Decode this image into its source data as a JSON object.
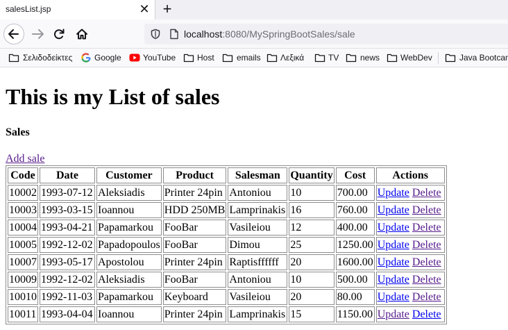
{
  "browser": {
    "tab": {
      "title": "salesList.jsp",
      "close_glyph": "✕"
    },
    "new_tab_glyph": "+",
    "url": {
      "host": "localhost",
      "rest": ":8080/MySpringBootSales/sale"
    },
    "bookmarks": [
      {
        "label": "Σελιδοδείκτες",
        "icon": "folder-icon"
      },
      {
        "label": "Google",
        "icon": "google-icon"
      },
      {
        "label": "YouTube",
        "icon": "youtube-icon"
      },
      {
        "label": "Host",
        "icon": "folder-icon"
      },
      {
        "label": "emails",
        "icon": "folder-icon"
      },
      {
        "label": "Λεξικά",
        "icon": "folder-icon"
      },
      {
        "label": "TV",
        "icon": "folder-icon"
      },
      {
        "label": "news",
        "icon": "folder-icon"
      },
      {
        "label": "WebDev",
        "icon": "folder-icon"
      },
      {
        "label": "Java Bootcam",
        "icon": "folder-icon"
      }
    ]
  },
  "page": {
    "title": "This is my List of sales",
    "subtitle": "Sales",
    "add_link": "Add sale"
  },
  "table": {
    "headers": [
      "Code",
      "Date",
      "Customer",
      "Product",
      "Salesman",
      "Quantity",
      "Cost",
      "Actions"
    ],
    "update_label": "Update",
    "delete_label": "Delete",
    "rows": [
      {
        "code": "10002",
        "date": "1993-07-12",
        "customer": "Aleksiadis",
        "product": "Printer 24pin",
        "salesman": "Antoniou",
        "quantity": "10",
        "cost": "700.00"
      },
      {
        "code": "10003",
        "date": "1993-03-15",
        "customer": "Ioannou",
        "product": "HDD 250MB",
        "salesman": "Lamprinakis",
        "quantity": "16",
        "cost": "760.00"
      },
      {
        "code": "10004",
        "date": "1993-04-21",
        "customer": "Papamarkou",
        "product": "FooBar",
        "salesman": "Vasileiou",
        "quantity": "12",
        "cost": "400.00"
      },
      {
        "code": "10005",
        "date": "1992-12-02",
        "customer": "Papadopoulos",
        "product": "FooBar",
        "salesman": "Dimou",
        "quantity": "25",
        "cost": "1250.00"
      },
      {
        "code": "10007",
        "date": "1993-05-17",
        "customer": "Apostolou",
        "product": "Printer 24pin",
        "salesman": "Raptisffffff",
        "quantity": "20",
        "cost": "1600.00"
      },
      {
        "code": "10009",
        "date": "1992-12-02",
        "customer": "Aleksiadis",
        "product": "FooBar",
        "salesman": "Antoniou",
        "quantity": "10",
        "cost": "500.00"
      },
      {
        "code": "10010",
        "date": "1992-11-03",
        "customer": "Papamarkou",
        "product": "Keyboard",
        "salesman": "Vasileiou",
        "quantity": "20",
        "cost": "80.00"
      },
      {
        "code": "10011",
        "date": "1993-04-04",
        "customer": "Ioannou",
        "product": "Printer 24pin",
        "salesman": "Lamprinakis",
        "quantity": "15",
        "cost": "1150.00"
      }
    ]
  },
  "colors": {
    "link": "#0000ee",
    "visited_link": "#551a8b"
  }
}
